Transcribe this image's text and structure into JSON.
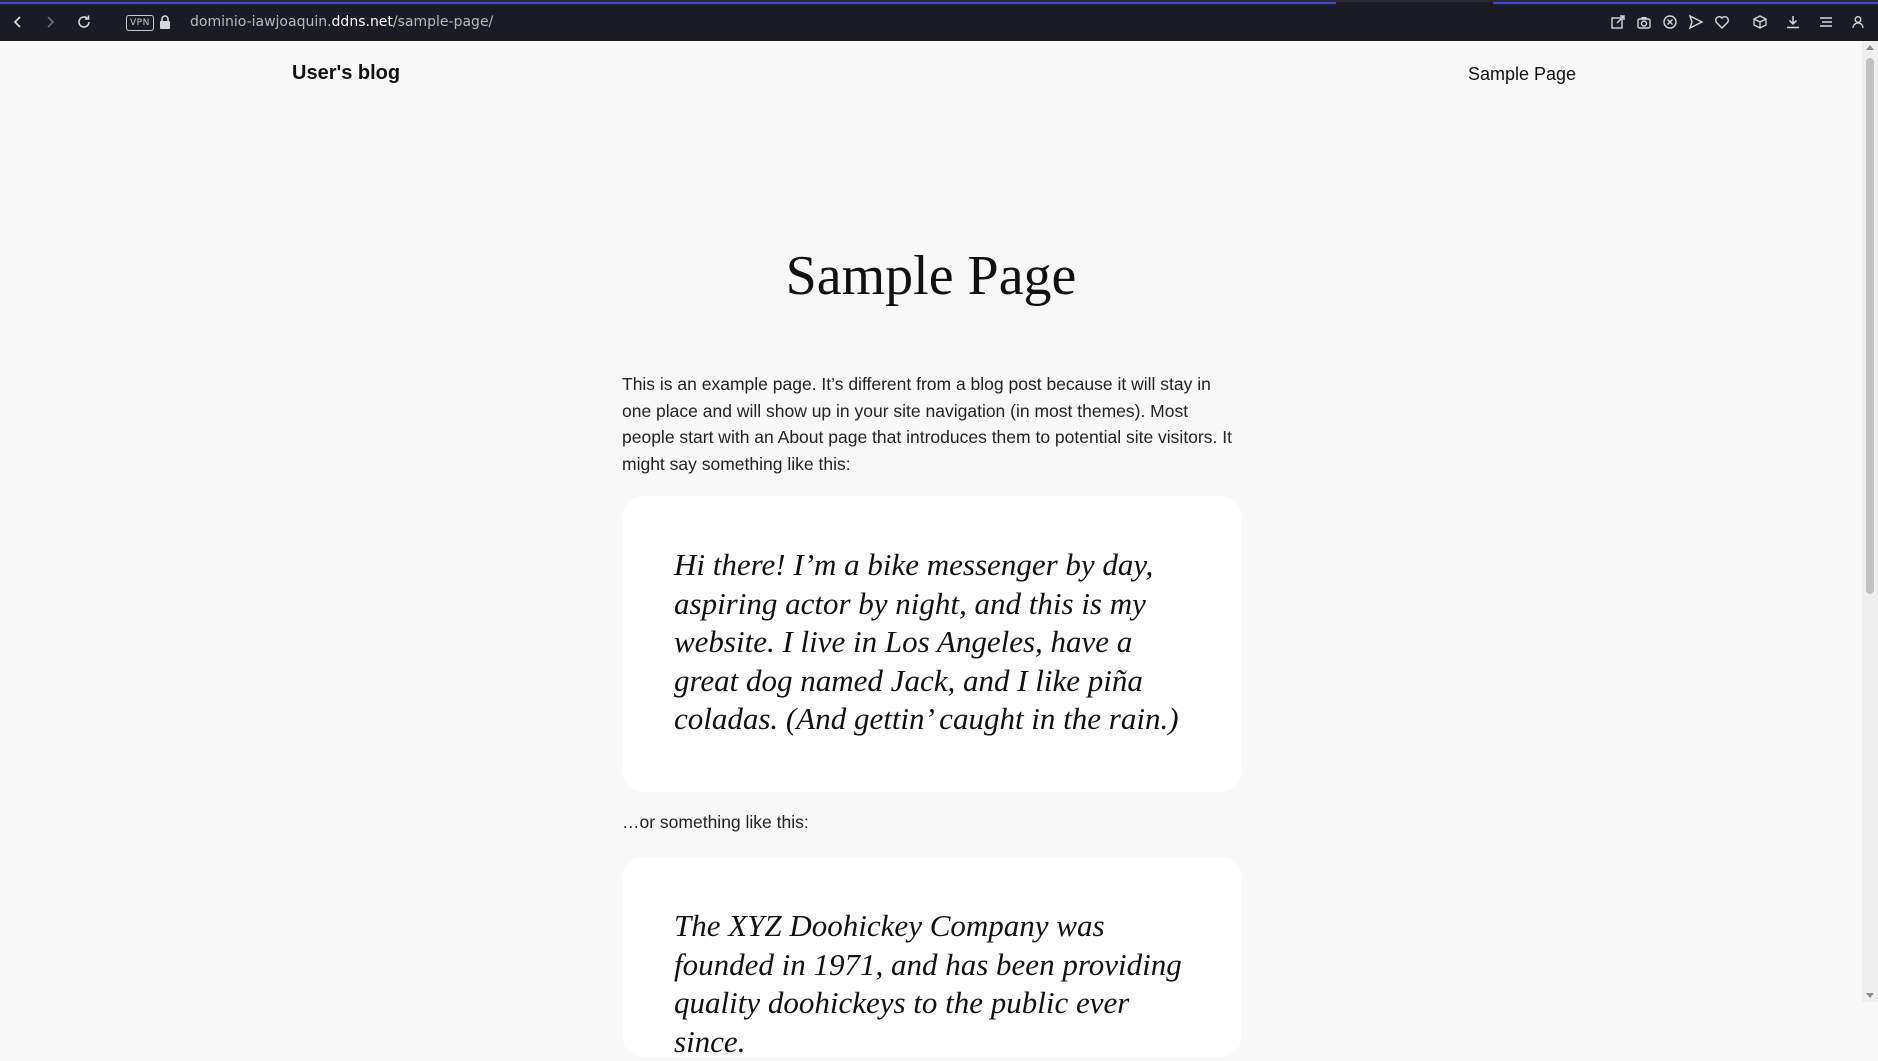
{
  "browser": {
    "url_prefix": "dominio-iawjoaquin.",
    "url_domain": "ddns.net",
    "url_path": "/sample-page/",
    "vpn_label": "VPN"
  },
  "site": {
    "title": "User's blog",
    "nav_item": "Sample Page"
  },
  "page": {
    "title": "Sample Page",
    "intro": "This is an example page. It’s different from a blog post because it will stay in one place and will show up in your site navigation (in most themes). Most people start with an About page that introduces them to potential site visitors. It might say something like this:",
    "quote1": "Hi there! I’m a bike messenger by day, aspiring actor by night, and this is my website. I live in Los Angeles, have a great dog named Jack, and I like piña coladas. (And gettin’ caught in the rain.)",
    "between": "…or something like this:",
    "quote2": "The XYZ Doohickey Company was founded in 1971, and has been providing quality doohickeys to the public ever since."
  }
}
